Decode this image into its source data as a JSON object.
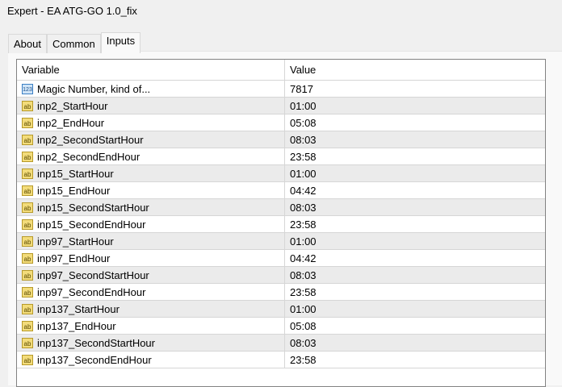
{
  "window": {
    "title": "Expert - EA ATG-GO 1.0_fix"
  },
  "tabs": [
    {
      "label": "About"
    },
    {
      "label": "Common"
    },
    {
      "label": "Inputs",
      "active": true
    }
  ],
  "table": {
    "headers": [
      "Variable",
      "Value"
    ],
    "rows": [
      {
        "icon": "123",
        "variable": "Magic Number, kind of...",
        "value": "7817"
      },
      {
        "icon": "ab",
        "variable": "inp2_StartHour",
        "value": "01:00"
      },
      {
        "icon": "ab",
        "variable": "inp2_EndHour",
        "value": "05:08"
      },
      {
        "icon": "ab",
        "variable": "inp2_SecondStartHour",
        "value": "08:03"
      },
      {
        "icon": "ab",
        "variable": "inp2_SecondEndHour",
        "value": "23:58"
      },
      {
        "icon": "ab",
        "variable": "inp15_StartHour",
        "value": "01:00"
      },
      {
        "icon": "ab",
        "variable": "inp15_EndHour",
        "value": "04:42"
      },
      {
        "icon": "ab",
        "variable": "inp15_SecondStartHour",
        "value": "08:03"
      },
      {
        "icon": "ab",
        "variable": "inp15_SecondEndHour",
        "value": "23:58"
      },
      {
        "icon": "ab",
        "variable": "inp97_StartHour",
        "value": "01:00"
      },
      {
        "icon": "ab",
        "variable": "inp97_EndHour",
        "value": "04:42"
      },
      {
        "icon": "ab",
        "variable": "inp97_SecondStartHour",
        "value": "08:03"
      },
      {
        "icon": "ab",
        "variable": "inp97_SecondEndHour",
        "value": "23:58"
      },
      {
        "icon": "ab",
        "variable": "inp137_StartHour",
        "value": "01:00"
      },
      {
        "icon": "ab",
        "variable": "inp137_EndHour",
        "value": "05:08"
      },
      {
        "icon": "ab",
        "variable": "inp137_SecondStartHour",
        "value": "08:03"
      },
      {
        "icon": "ab",
        "variable": "inp137_SecondEndHour",
        "value": "23:58"
      }
    ]
  }
}
